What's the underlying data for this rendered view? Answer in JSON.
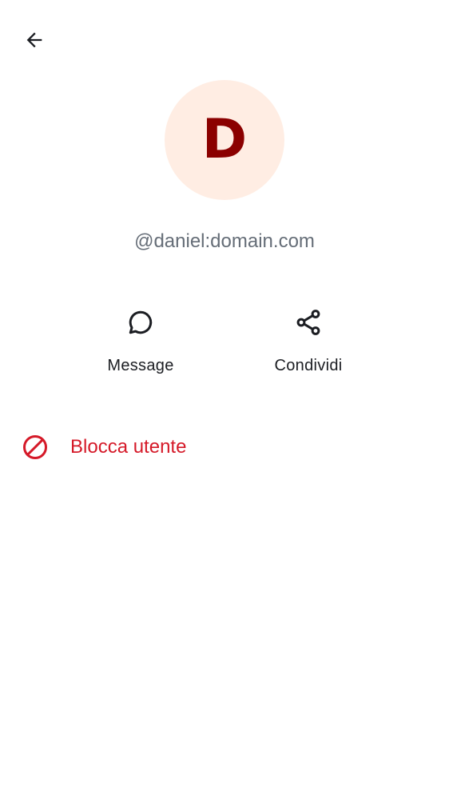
{
  "header": {
    "back_icon": "arrow-left-icon"
  },
  "profile": {
    "avatar_initial": "D",
    "avatar_bg_color": "#ffede3",
    "avatar_text_color": "#8b0000",
    "user_id": "@daniel:domain.com"
  },
  "actions": {
    "message": {
      "label": "Message",
      "icon": "chat-bubble-icon"
    },
    "share": {
      "label": "Condividi",
      "icon": "share-icon"
    }
  },
  "block": {
    "label": "Blocca utente",
    "icon": "block-icon",
    "color": "#d51928"
  }
}
